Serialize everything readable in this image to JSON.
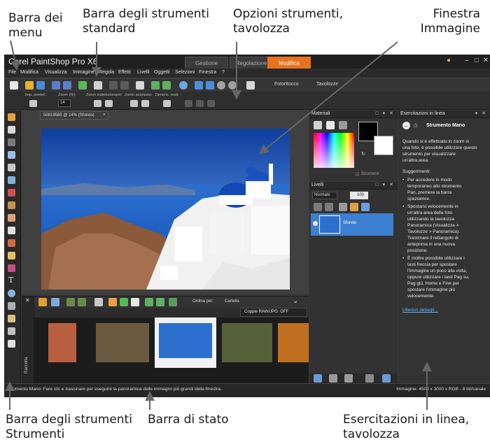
{
  "callouts": {
    "menu_bar": [
      "Barra dei",
      "menu"
    ],
    "standard_toolbar": [
      "Barra degli strumenti",
      "standard"
    ],
    "tool_options": [
      "Opzioni strumenti,",
      "tavolozza"
    ],
    "image_window": [
      "Finestra",
      "Immagine"
    ],
    "tools_toolbar": [
      "Barra degli strumenti",
      "Strumenti"
    ],
    "status_bar": [
      "Barra di stato"
    ],
    "learning_center": [
      "Esercitazioni in linea,",
      "tavolozza"
    ]
  },
  "app": {
    "title": "Corel PaintShop Pro X6",
    "workspace_tabs": [
      {
        "label": "Gestione",
        "active": false
      },
      {
        "label": "Regolazione",
        "active": false
      },
      {
        "label": "Modifica",
        "active": true
      }
    ],
    "accent_color": "#e8721c"
  },
  "menu": [
    "File",
    "Modifica",
    "Visualizza",
    "Immagine",
    "Regola",
    "Effetti",
    "Livelli",
    "Oggetti",
    "Selezioni",
    "Finestra",
    "?"
  ],
  "standard_toolbar": {
    "photo_fix_label": "Fotoritocco",
    "palettes_label": "Tavolozze"
  },
  "tool_options": {
    "preset_label": "Imp. predef.:",
    "zoom_pct_label": "Zoom (%):",
    "zoom_value": "14",
    "zoom_in_out_label": "Zoom indietro/avanti:",
    "zoom_more_label": "Zoom avanzato:",
    "actual_size_label": "Dimens. reali:"
  },
  "document": {
    "tab_label": "50819585 @  14% (Sfondo)",
    "close_glyph": "×"
  },
  "organizer": {
    "vertical_label": "Raccolta",
    "sort_label": "Ordina per:",
    "sort_value": "Cartella",
    "raw_jpg_popup": "Coppie RAW/JPG: OFF"
  },
  "materials": {
    "title": "Materiali",
    "checkbox_label": "Strumenti"
  },
  "layers": {
    "title": "Livelli",
    "blend_mode": "Normale",
    "opacity": "100",
    "layer_name": "Sfondo"
  },
  "learning_center": {
    "title": "Esercitazioni in linea",
    "heading": "Strumento Mano",
    "intro": [
      "Quando si è effettuato lo zoom in",
      "una foto, è possibile utilizzare questo",
      "strumento per visualizzare",
      "un'altra area."
    ],
    "tips_label": "Suggerimenti:",
    "tips": [
      [
        "Per accedere in modo",
        "temporaneo allo strumento",
        "Pan, premere la barra",
        "spaziatrice."
      ],
      [
        "Spostarsi velocemente in",
        "un'altra area della foto",
        "utilizzando la tavolozza",
        "Panoramica (Visualizza >",
        "Tavolozze > Panoramica).",
        "Trascinare il rettangolo di",
        "anteprima in una nuova",
        "posizione."
      ],
      [
        "È inoltre possibile utilizzare i",
        "tasti freccia per spostare",
        "l'immagine un poco alla volta,",
        "oppure utilizzare i tasti Pag su,",
        "Pag giù, Home e Fine per",
        "spostare l'immagine più",
        "velocemente."
      ]
    ],
    "more_link": "Ulteriori dettagli..."
  },
  "status": {
    "left": "Strumento Mano: Fare clic e trascinare per eseguire la panoramica delle immagini più grandi della finestra.",
    "right": "Immagine: 4500 x 3000 x RGB - 8 bit/canale"
  }
}
